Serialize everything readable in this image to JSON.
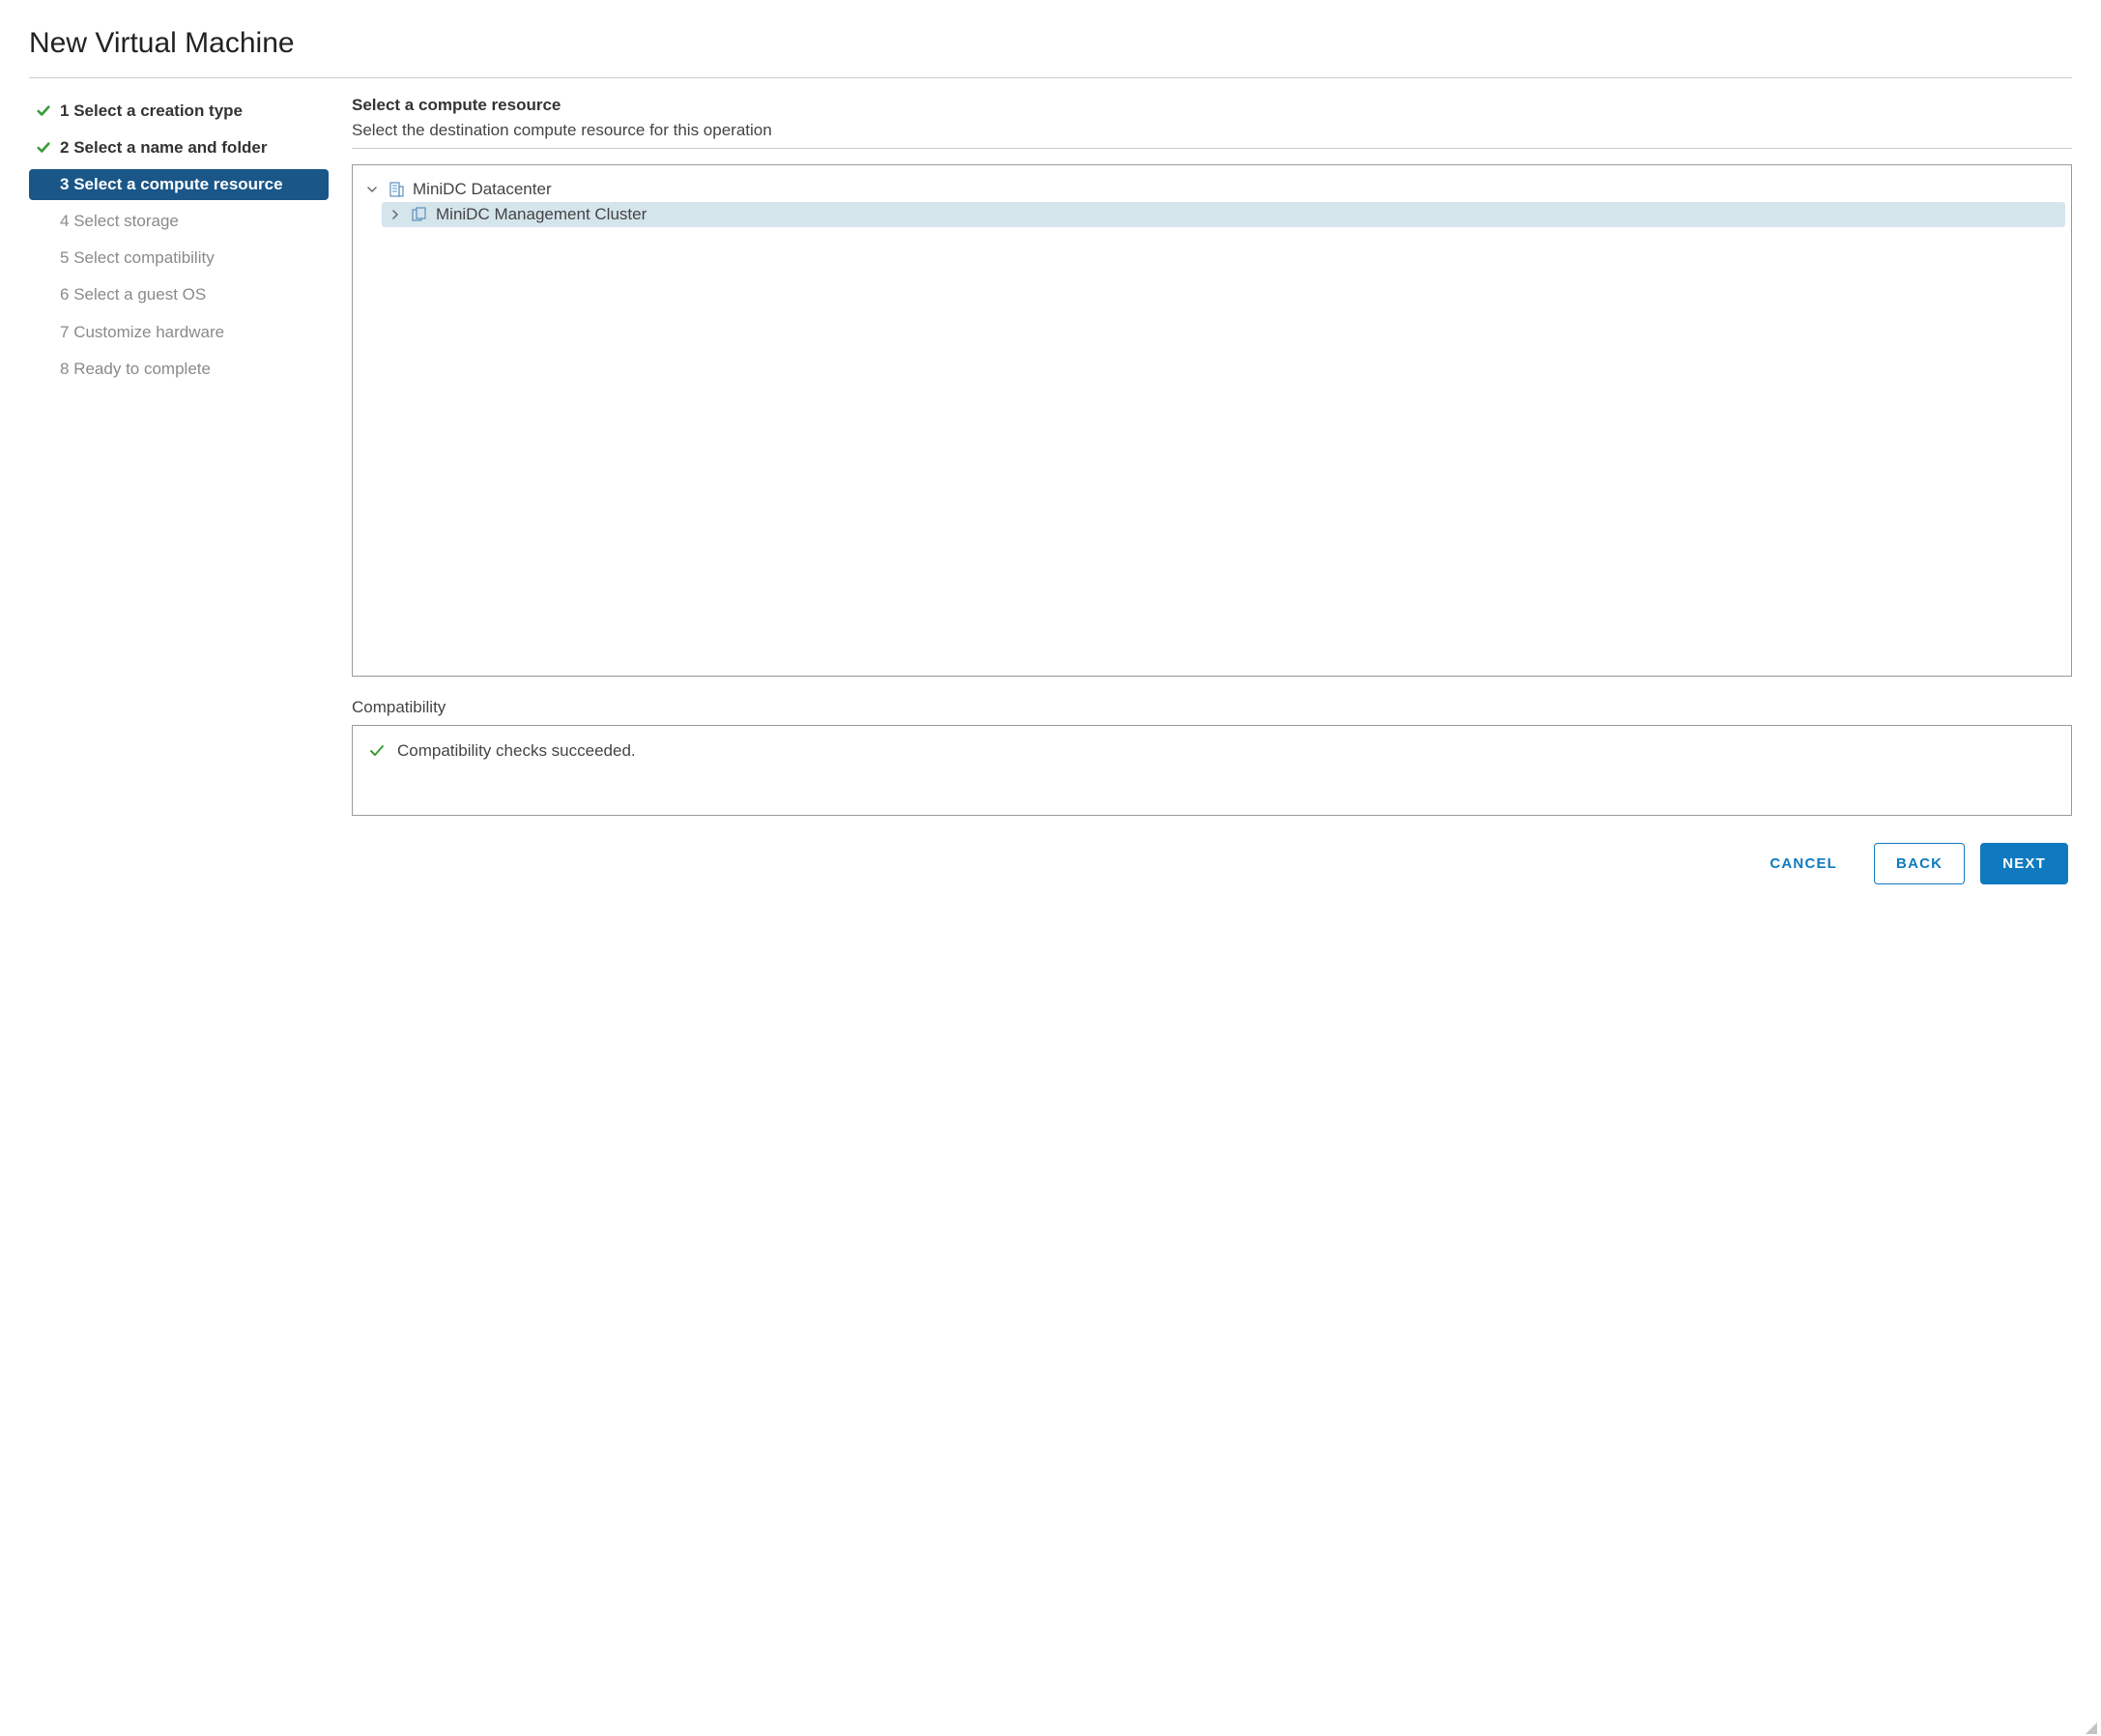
{
  "dialog": {
    "title": "New Virtual Machine"
  },
  "steps": [
    {
      "num": "1",
      "label": "Select a creation type",
      "state": "completed"
    },
    {
      "num": "2",
      "label": "Select a name and folder",
      "state": "completed"
    },
    {
      "num": "3",
      "label": "Select a compute resource",
      "state": "active"
    },
    {
      "num": "4",
      "label": "Select storage",
      "state": "pending"
    },
    {
      "num": "5",
      "label": "Select compatibility",
      "state": "pending"
    },
    {
      "num": "6",
      "label": "Select a guest OS",
      "state": "pending"
    },
    {
      "num": "7",
      "label": "Customize hardware",
      "state": "pending"
    },
    {
      "num": "8",
      "label": "Ready to complete",
      "state": "pending"
    }
  ],
  "main": {
    "heading": "Select a compute resource",
    "subheading": "Select the destination compute resource for this operation"
  },
  "tree": {
    "root": {
      "label": "MiniDC Datacenter",
      "expanded": true,
      "type": "datacenter",
      "children": [
        {
          "label": "MiniDC Management Cluster",
          "expanded": false,
          "type": "cluster",
          "selected": true
        }
      ]
    }
  },
  "compatibility": {
    "label": "Compatibility",
    "message": "Compatibility checks succeeded."
  },
  "footer": {
    "cancel": "Cancel",
    "back": "Back",
    "next": "Next"
  }
}
